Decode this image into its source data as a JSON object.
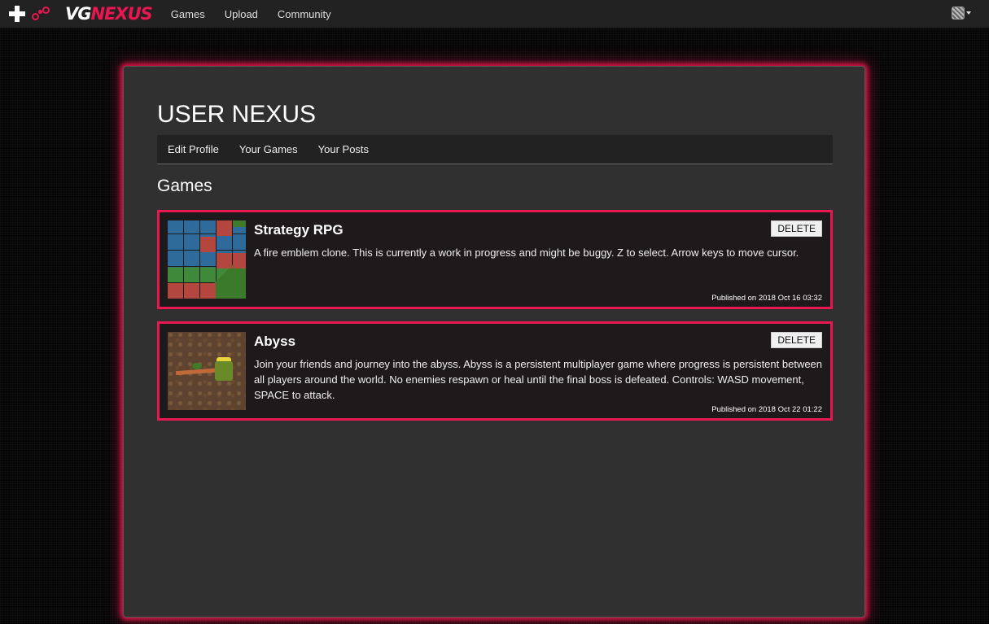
{
  "navbar": {
    "logo_vg": "VG",
    "logo_nexus": "NEXUS",
    "links": [
      "Games",
      "Upload",
      "Community"
    ],
    "user_icon": "user-avatar-icon"
  },
  "page": {
    "title": "USER NEXUS",
    "tabs": [
      "Edit Profile",
      "Your Games",
      "Your Posts"
    ],
    "section_title": "Games"
  },
  "games": [
    {
      "title": "Strategy RPG",
      "description": "A fire emblem clone. This is currently a work in progress and might be buggy. Z to select. Arrow keys to move cursor.",
      "published": "Published on 2018 Oct 16 03:32",
      "delete_label": "DELETE"
    },
    {
      "title": "Abyss",
      "description": "Join your friends and journey into the abyss. Abyss is a persistent multiplayer game where progress is persistent between all players around the world. No enemies respawn or heal until the final boss is defeated. Controls: WASD movement, SPACE to attack.",
      "published": "Published on 2018 Oct 22 01:22",
      "delete_label": "DELETE"
    }
  ],
  "colors": {
    "accent": "#e8174f",
    "navbar_bg": "#222222",
    "panel_bg": "#303030",
    "card_bg": "#1e1a1b"
  }
}
